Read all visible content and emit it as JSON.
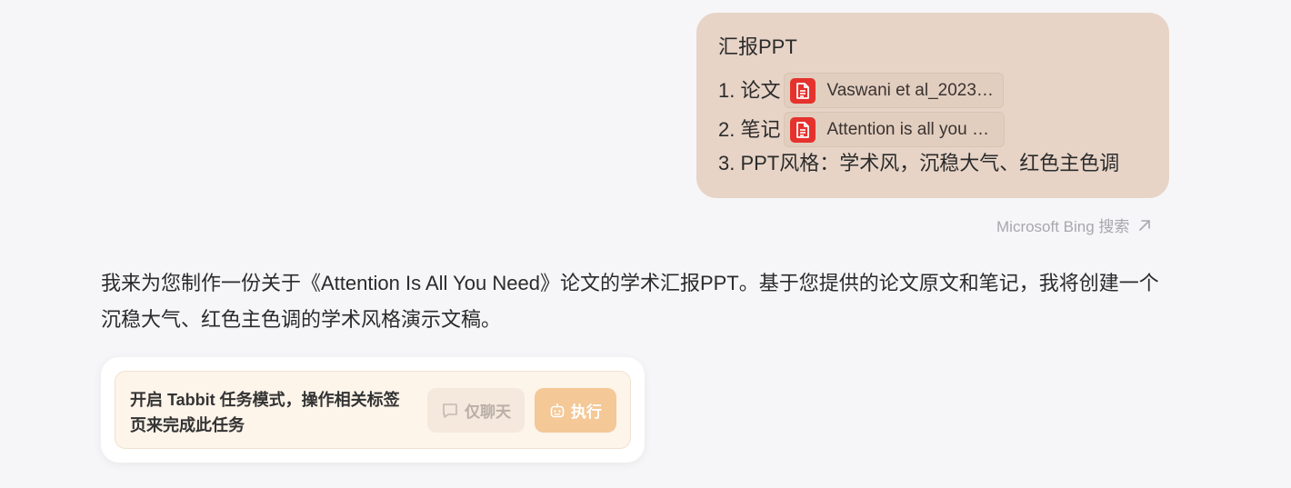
{
  "user_message": {
    "title": "汇报PPT",
    "items": [
      {
        "prefix": "1. 论文",
        "file_name": "Vaswani et al_2023_...",
        "file_icon": "pdf-file-icon"
      },
      {
        "prefix": "2. 笔记",
        "file_name": "Attention is all you n...",
        "file_icon": "pdf-file-icon"
      },
      {
        "prefix": "3. PPT风格：学术风，沉稳大气、红色主色调"
      }
    ],
    "bubble_color": "#e7d4c7"
  },
  "bing_search": {
    "label": "Microsoft Bing 搜索",
    "icon": "external-arrow-icon"
  },
  "assistant_message": {
    "text": "我来为您制作一份关于《Attention Is All You Need》论文的学术汇报PPT。基于您提供的论文原文和笔记，我将创建一个沉稳大气、红色主色调的学术风格演示文稿。"
  },
  "task_mode_card": {
    "prompt": "开启 Tabbit 任务模式，操作相关标签页来完成此任务",
    "chat_only_label": "仅聊天",
    "chat_only_icon": "chat-bubble-icon",
    "execute_label": "执行",
    "execute_icon": "robot-icon",
    "accent_color": "#f4c897"
  }
}
